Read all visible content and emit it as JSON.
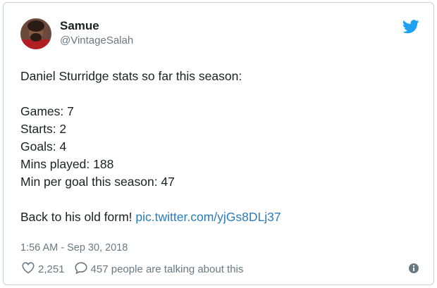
{
  "author": {
    "name": "Samue",
    "handle": "@VintageSalah",
    "avatar_icon": "avatar"
  },
  "tweet": {
    "intro": "Daniel Sturridge stats so far this season:",
    "stats": [
      "Games: 7",
      "Starts: 2",
      "Goals: 4",
      "Mins played: 188",
      "Min per goal this season: 47"
    ],
    "closing_text": "Back to his old form!",
    "link": "pic.twitter.com/yjGs8DLj37",
    "timestamp": "1:56 AM - Sep 30, 2018"
  },
  "actions": {
    "likes_count": "2,251",
    "talking_text": "457 people are talking about this",
    "heart_icon": "heart-icon",
    "reply_icon": "reply-bubble-icon",
    "info_icon": "info-icon"
  },
  "colors": {
    "twitter_blue": "#1da1f2",
    "link_blue": "#2b7bb9",
    "muted_gray": "#697882",
    "text_dark": "#1c2022"
  }
}
